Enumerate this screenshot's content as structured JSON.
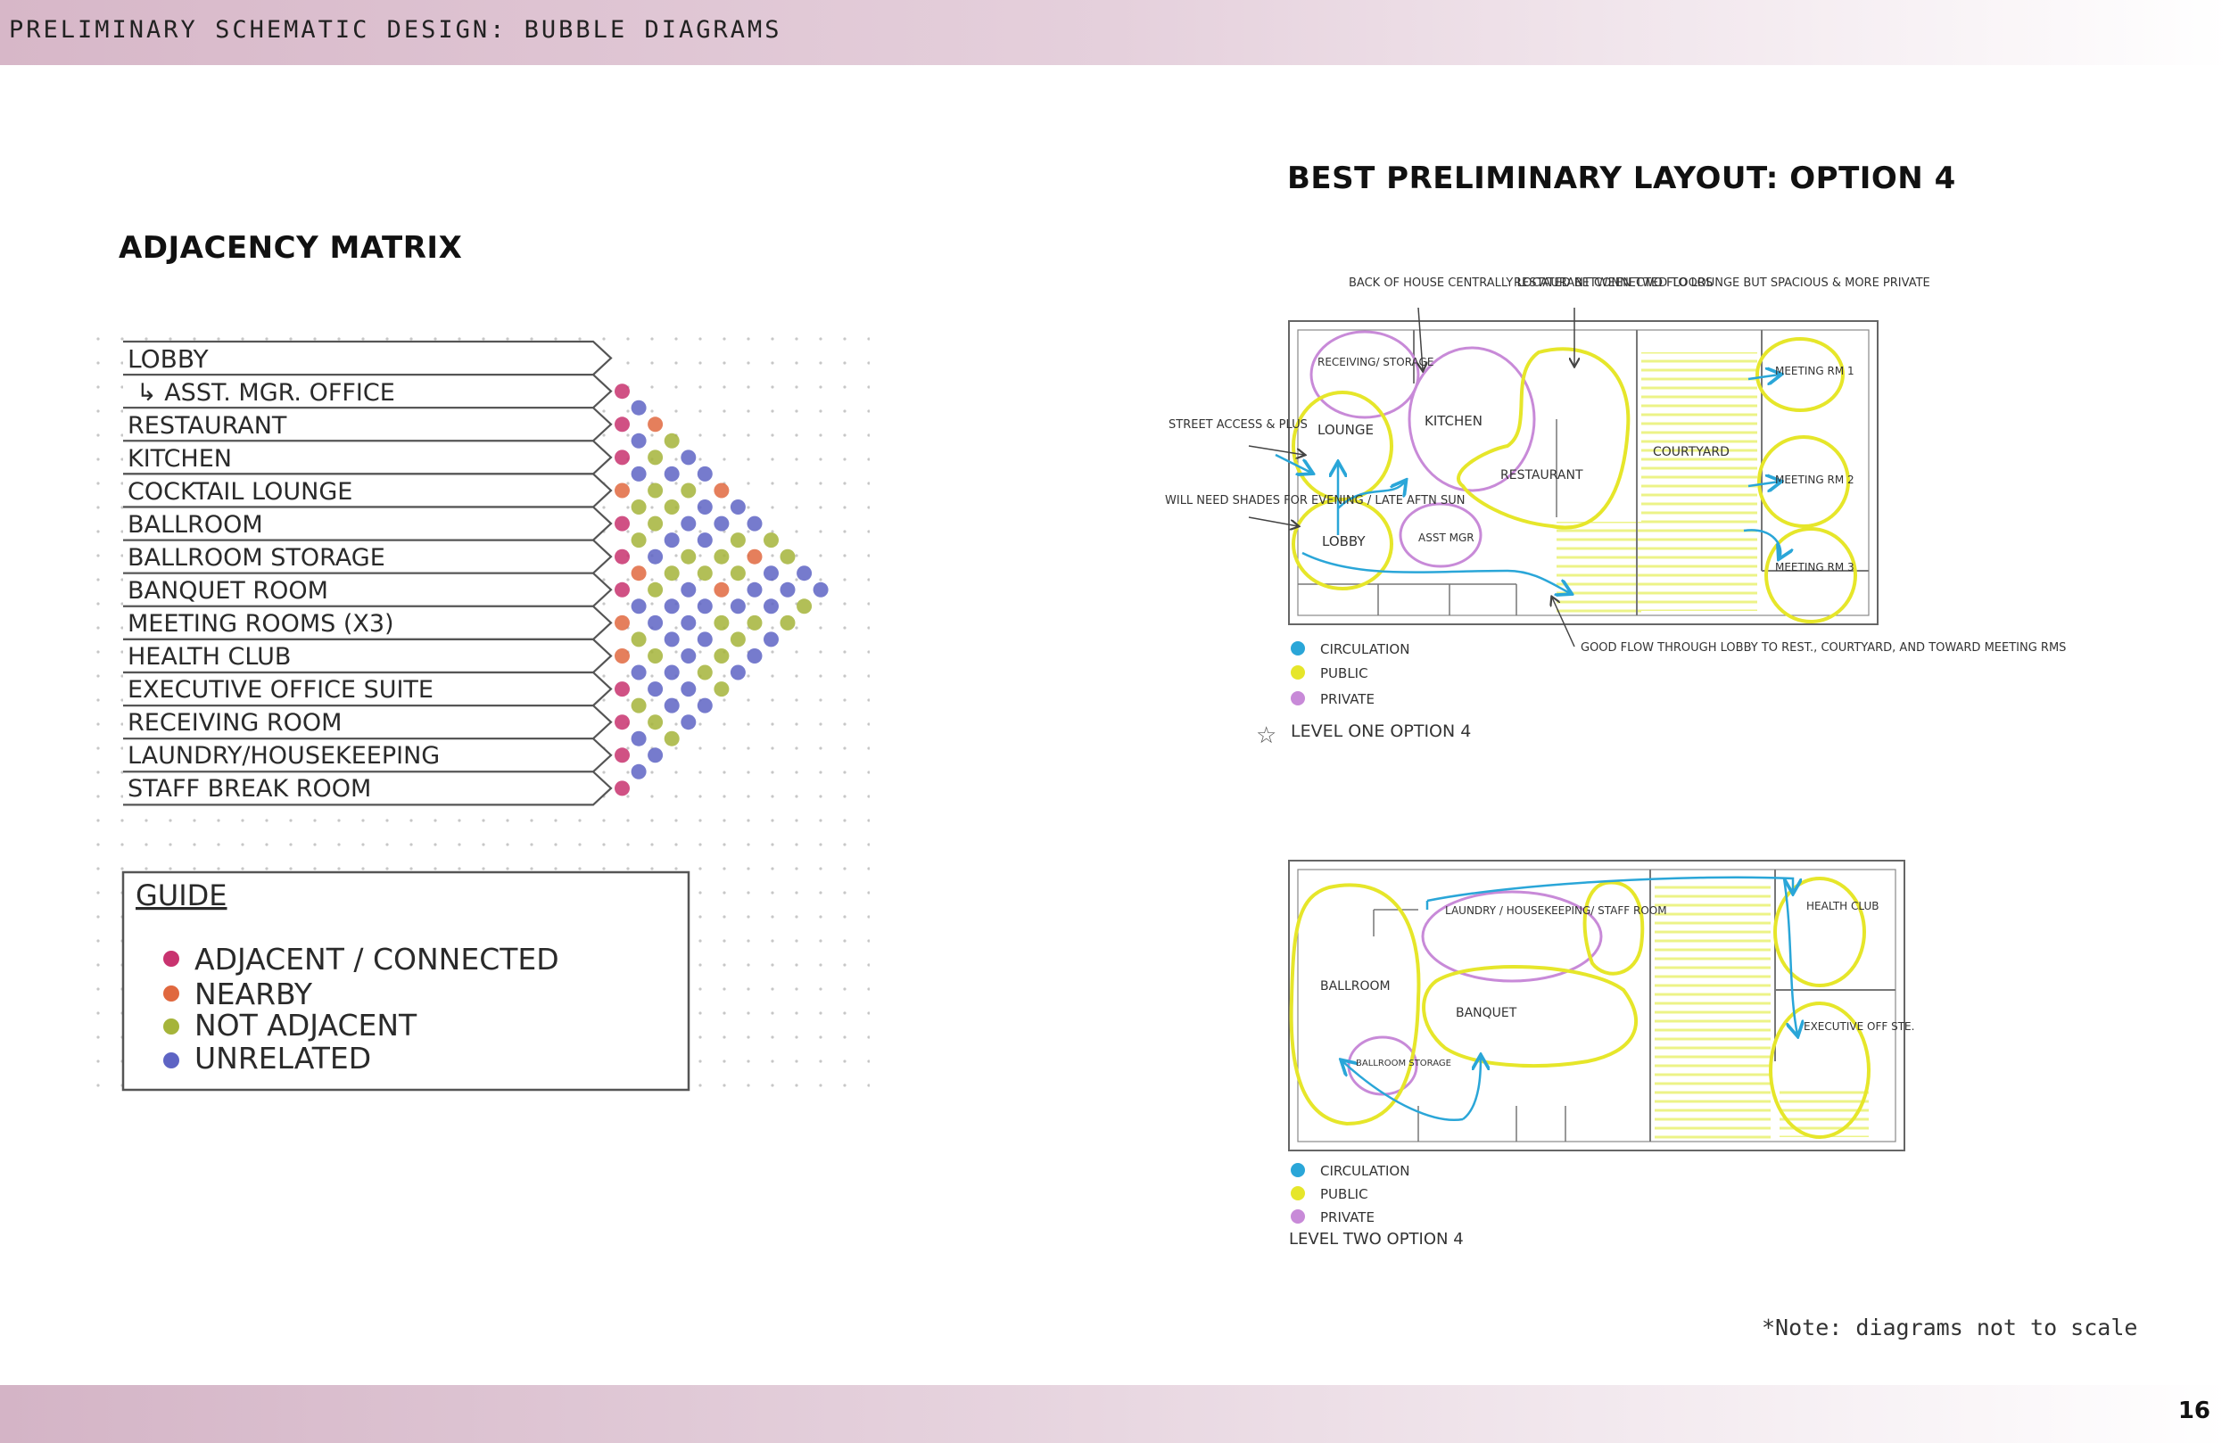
{
  "header": {
    "title": "PRELIMINARY SCHEMATIC DESIGN: BUBBLE DIAGRAMS"
  },
  "page_number": "16",
  "matrix": {
    "title": "ADJACENCY MATRIX",
    "rows": [
      "LOBBY",
      "↳ ASST. MGR. OFFICE",
      "RESTAURANT",
      "KITCHEN",
      "COCKTAIL LOUNGE",
      "BALLROOM",
      "BALLROOM STORAGE",
      "BANQUET ROOM",
      "MEETING ROOMS (X3)",
      "HEALTH CLUB",
      "EXECUTIVE OFFICE SUITE",
      "RECEIVING ROOM",
      "LAUNDRY/HOUSEKEEPING",
      "STAFF BREAK ROOM"
    ]
  },
  "guide": {
    "title": "GUIDE",
    "items": [
      {
        "label": "ADJACENT / CONNECTED",
        "color": "#c8336f"
      },
      {
        "label": "NEARBY",
        "color": "#e0683f"
      },
      {
        "label": "NOT ADJACENT",
        "color": "#a5b43a"
      },
      {
        "label": "UNRELATED",
        "color": "#5e64c4"
      }
    ]
  },
  "layout": {
    "title": "BEST PRELIMINARY LAYOUT: OPTION 4",
    "level_one": {
      "annotations": {
        "back_of_house": "BACK OF HOUSE CENTRALLY LOCATED BETWEEN TWO FLOORS",
        "restaurant_note": "RESTAURANT CONNECTED TO LOUNGE BUT SPACIOUS & MORE PRIVATE",
        "street_access": "STREET ACCESS & PLUS",
        "shades": "WILL NEED SHADES FOR EVENING / LATE AFTN SUN",
        "flow": "GOOD FLOW THROUGH LOBBY TO REST., COURTYARD, AND TOWARD MEETING RMS"
      },
      "rooms": {
        "receiving": "RECEIVING/ STORAGE",
        "kitchen": "KITCHEN",
        "lounge": "LOUNGE",
        "restaurant": "RESTAURANT",
        "courtyard": "COURTYARD",
        "lobby": "LOBBY",
        "asst_mgr": "ASST MGR",
        "meeting1": "MEETING RM 1",
        "meeting2": "MEETING RM 2",
        "meeting3": "MEETING RM 3"
      },
      "legend": [
        "CIRCULATION",
        "PUBLIC",
        "PRIVATE"
      ],
      "caption": "LEVEL ONE OPTION 4"
    },
    "level_two": {
      "rooms": {
        "laundry": "LAUNDRY / HOUSEKEEPING/ STAFF ROOM",
        "health": "HEALTH CLUB",
        "ballroom": "BALLROOM",
        "banquet": "BANQUET",
        "executive": "EXECUTIVE OFF STE.",
        "storage": "BALLROOM STORAGE"
      },
      "legend": [
        "CIRCULATION",
        "PUBLIC",
        "PRIVATE"
      ],
      "caption": "LEVEL TWO OPTION 4"
    },
    "colors": {
      "circulation": "#2aa6d8",
      "public": "#e6e62a",
      "private": "#c88ad8"
    }
  },
  "footnote": "*Note: diagrams not to scale"
}
